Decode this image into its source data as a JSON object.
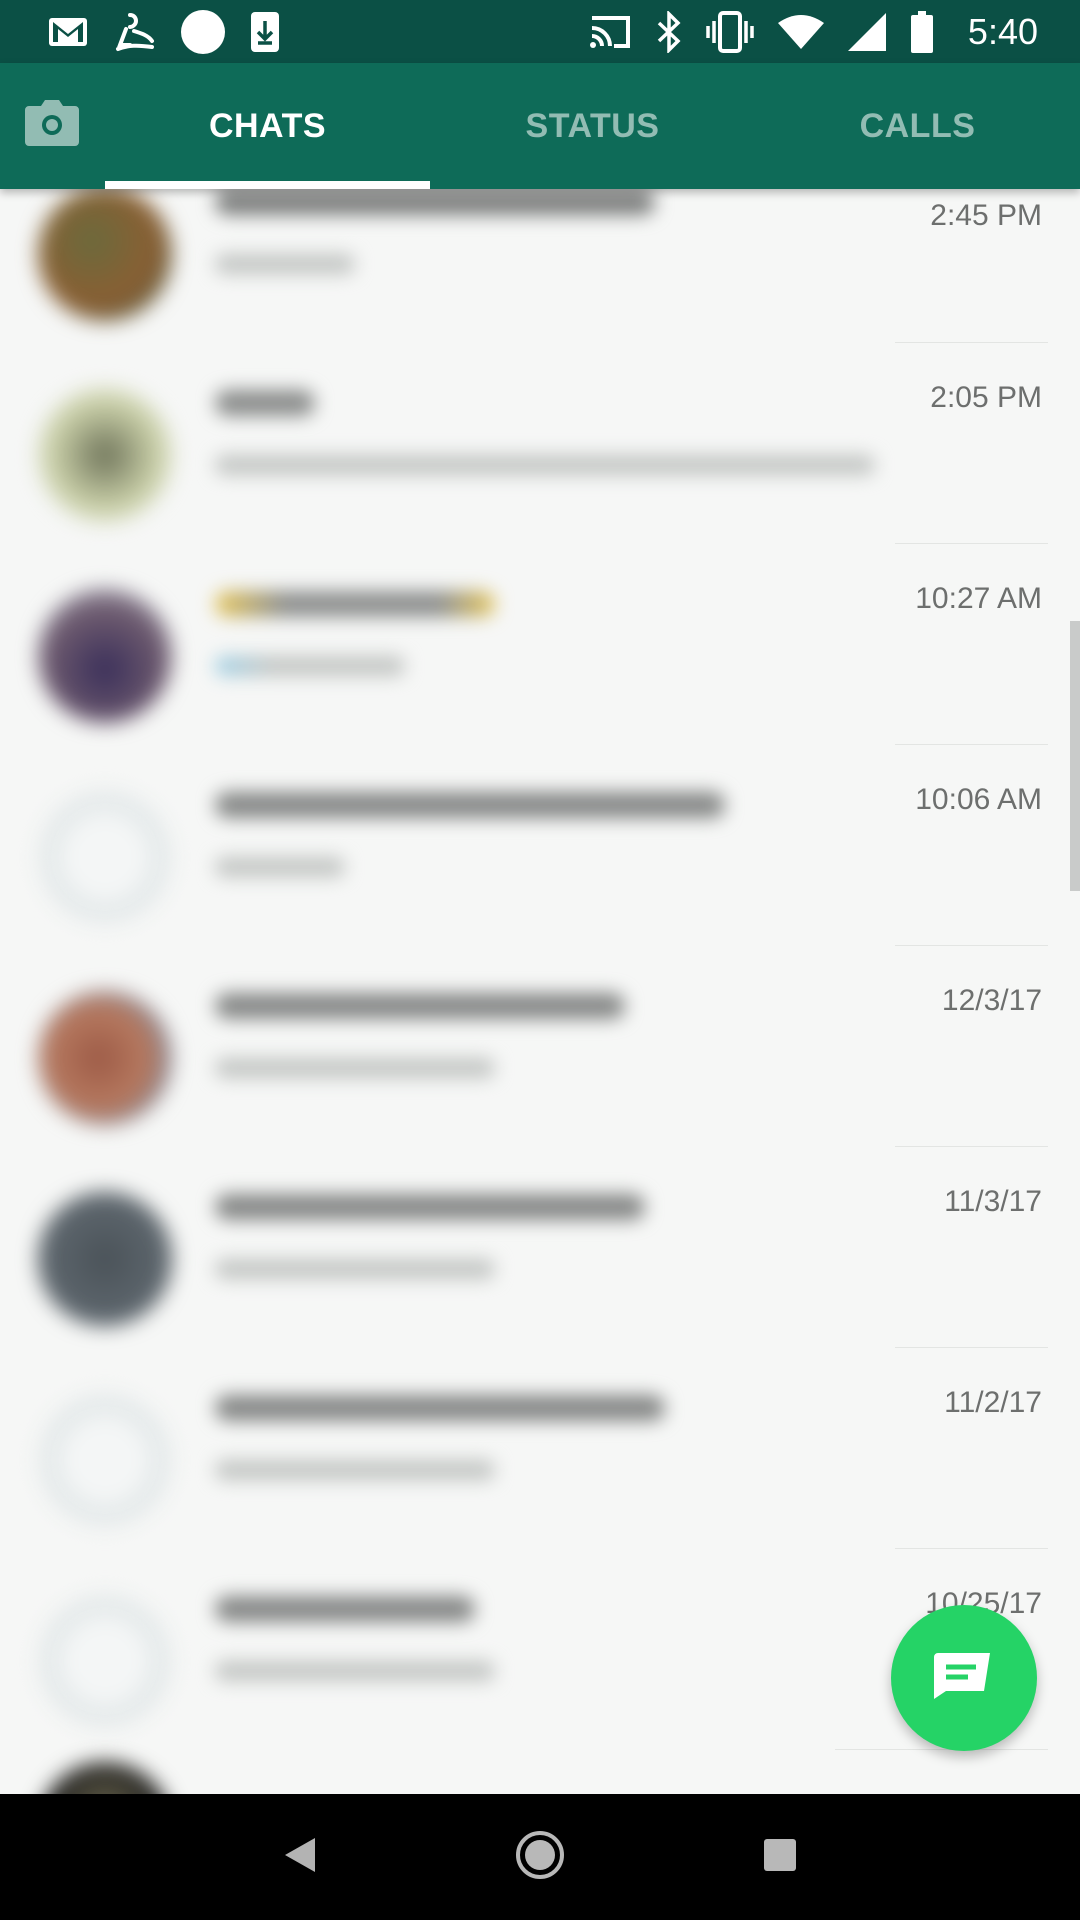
{
  "status_bar": {
    "time": "5:40",
    "left_icons": [
      "gmail-icon",
      "assistant-icon",
      "circle-icon",
      "download-icon"
    ],
    "right_icons": [
      "cast-icon",
      "bluetooth-icon",
      "vibrate-icon",
      "wifi-icon",
      "signal-icon",
      "battery-icon"
    ]
  },
  "tabs": {
    "camera_icon": "camera-icon",
    "chats": "CHATS",
    "status": "STATUS",
    "calls": "CALLS",
    "active": "CHATS"
  },
  "chats": [
    {
      "time": "2:45 PM"
    },
    {
      "time": "2:05 PM"
    },
    {
      "time": "10:27 AM"
    },
    {
      "time": "10:06 AM"
    },
    {
      "time": "12/3/17"
    },
    {
      "time": "11/3/17"
    },
    {
      "time": "11/2/17"
    },
    {
      "time": "10/25/17"
    }
  ],
  "fab": {
    "icon": "new-chat-icon"
  },
  "nav": {
    "icons": [
      "back-icon",
      "home-icon",
      "recents-icon"
    ]
  },
  "colors": {
    "status_bar": "#0b5045",
    "app_bar": "#0e6b58",
    "fab": "#25d366",
    "background": "#f6f7f6"
  }
}
